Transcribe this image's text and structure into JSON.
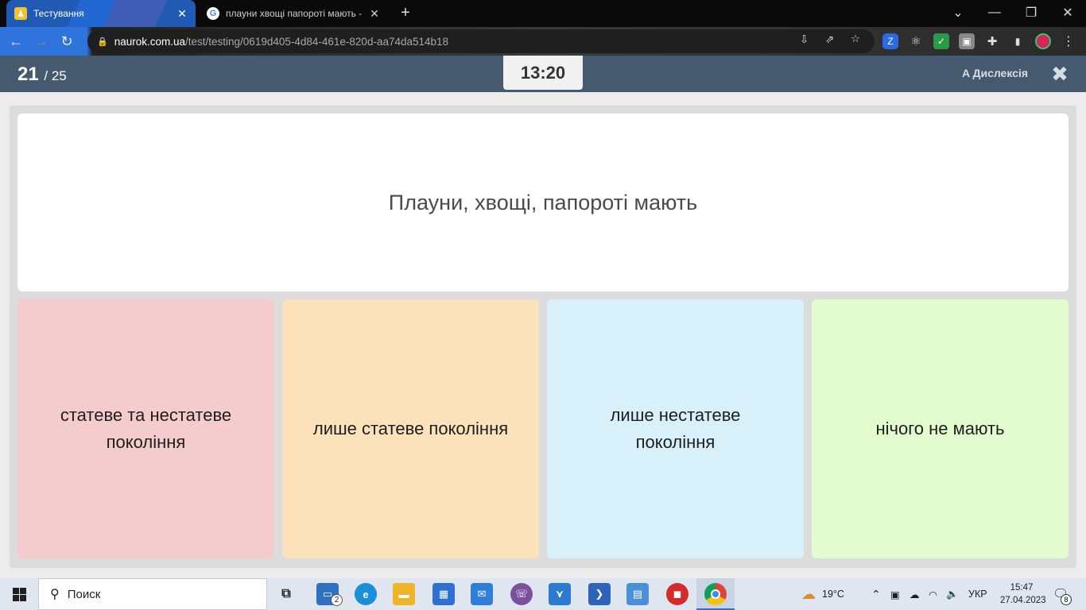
{
  "browser": {
    "tabs": [
      {
        "title": "Тестування",
        "active": true
      },
      {
        "title": "плауни хвощі папороті мають -",
        "active": false
      }
    ],
    "new_tab": "+",
    "url_host": "naurok.com.ua",
    "url_path": "/test/testing/0619d405-4d84-461e-820d-aa74da514b18"
  },
  "app": {
    "question_current": "21",
    "question_total": "/ 25",
    "timer": "13:20",
    "dyslexia_label": "Дислексія",
    "close": "✖"
  },
  "question": {
    "text": "Плауни, хвощі, папороті мають"
  },
  "answers": [
    {
      "label": "статеве та нестатеве покоління",
      "color": "#f5cccd"
    },
    {
      "label": "лише статеве покоління",
      "color": "#fbe2ba"
    },
    {
      "label": "лише нестатеве покоління",
      "color": "#d8f0fa"
    },
    {
      "label": "нічого не мають",
      "color": "#e2fccf"
    }
  ],
  "taskbar": {
    "search_placeholder": "Поиск",
    "weather": "19°C",
    "language": "УКР",
    "time": "15:47",
    "date": "27.04.2023",
    "notifications": "8",
    "badge_count": "2"
  }
}
